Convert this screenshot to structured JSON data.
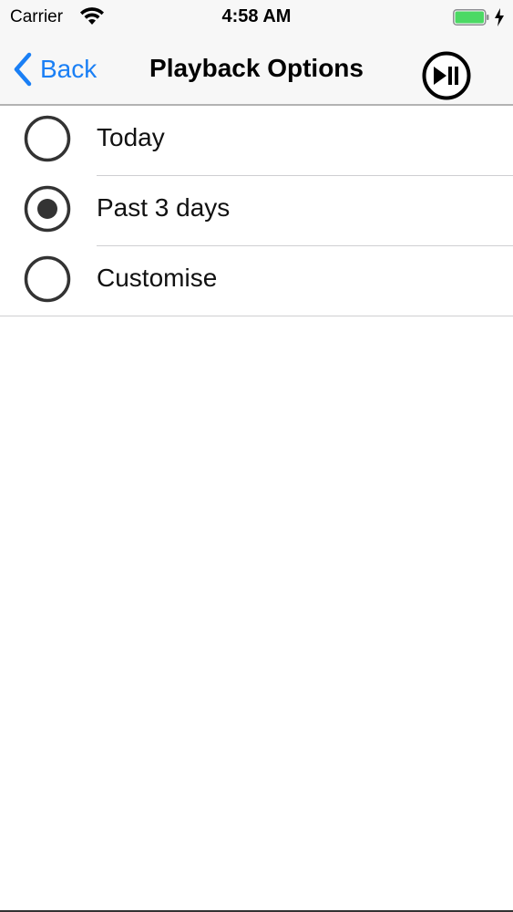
{
  "status_bar": {
    "carrier": "Carrier",
    "time": "4:58 AM",
    "battery_color": "#4cd964"
  },
  "nav_bar": {
    "back_label": "Back",
    "title": "Playback Options",
    "accent_color": "#1a7ff5",
    "right_icon": "play-pause-icon"
  },
  "options": [
    {
      "label": "Today",
      "selected": false
    },
    {
      "label": "Past 3 days",
      "selected": true
    },
    {
      "label": "Customise",
      "selected": false
    }
  ]
}
